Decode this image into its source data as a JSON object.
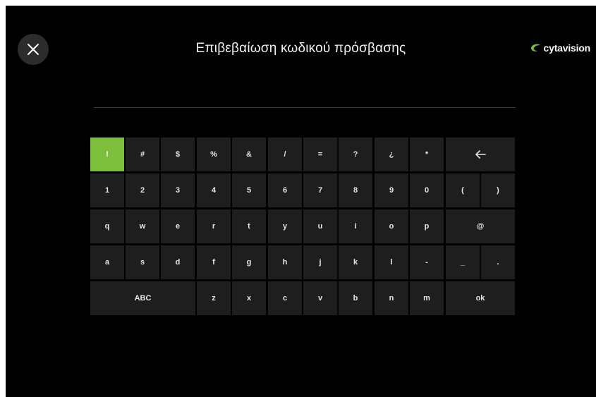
{
  "header": {
    "title": "Επιβεβαίωση κωδικού πρόσβασης",
    "logo_text": "cytavision",
    "close_icon": "close-icon",
    "brand_color": "#7dbf3b"
  },
  "password_field": {
    "value": ""
  },
  "keyboard": {
    "row1": [
      "!",
      "#",
      "$",
      "%",
      "&",
      "/",
      "=",
      "?",
      "¿",
      "*"
    ],
    "backspace_icon": "backspace-arrow-icon",
    "row2": [
      "1",
      "2",
      "3",
      "4",
      "5",
      "6",
      "7",
      "8",
      "9",
      "0"
    ],
    "row2_extra": [
      "(",
      ")"
    ],
    "row3": [
      "q",
      "w",
      "e",
      "r",
      "t",
      "y",
      "u",
      "i",
      "o",
      "p"
    ],
    "row3_extra": "@",
    "row4": [
      "a",
      "s",
      "d",
      "f",
      "g",
      "h",
      "j",
      "k",
      "l",
      "-"
    ],
    "row4_extra": [
      "_",
      "."
    ],
    "row5_abc": "ABC",
    "row5": [
      "z",
      "x",
      "c",
      "v",
      "b",
      "n",
      "m"
    ],
    "ok": "ok",
    "active_key": "!"
  }
}
